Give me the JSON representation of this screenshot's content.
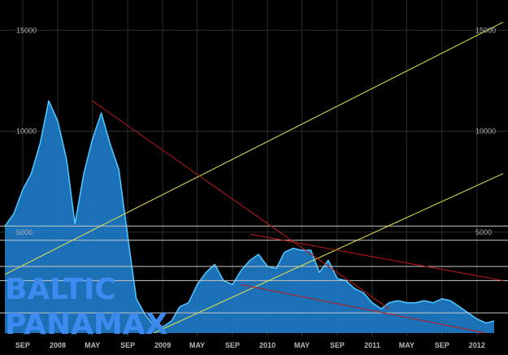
{
  "chart_data": {
    "type": "area",
    "title": "",
    "watermark": [
      "BALTIC",
      "PANAMAX"
    ],
    "xlabel": "",
    "ylabel": "",
    "x_tick_labels": [
      "SEP",
      "2008",
      "MAY",
      "SEP",
      "2009",
      "MAY",
      "SEP",
      "2010",
      "MAY",
      "SEP",
      "2011",
      "MAY",
      "SEP",
      "2012"
    ],
    "y_tick_labels": [
      "15000",
      "10000",
      "5000"
    ],
    "ylim": [
      0,
      16500
    ],
    "y_ticks": [
      5000,
      10000,
      15000
    ],
    "x": [
      "2007-07",
      "2007-08",
      "2007-09",
      "2007-10",
      "2007-11",
      "2007-12",
      "2008-01",
      "2008-02",
      "2008-03",
      "2008-04",
      "2008-05",
      "2008-06",
      "2008-07",
      "2008-08",
      "2008-09",
      "2008-10",
      "2008-11",
      "2008-12",
      "2009-01",
      "2009-02",
      "2009-03",
      "2009-04",
      "2009-05",
      "2009-06",
      "2009-07",
      "2009-08",
      "2009-09",
      "2009-10",
      "2009-11",
      "2009-12",
      "2010-01",
      "2010-02",
      "2010-03",
      "2010-04",
      "2010-05",
      "2010-06",
      "2010-07",
      "2010-08",
      "2010-09",
      "2010-10",
      "2010-11",
      "2010-12",
      "2011-01",
      "2011-02",
      "2011-03",
      "2011-04",
      "2011-05",
      "2011-06",
      "2011-07",
      "2011-08",
      "2011-09",
      "2011-10",
      "2011-11",
      "2011-12",
      "2012-01",
      "2012-02",
      "2012-03"
    ],
    "series": [
      {
        "color": "#1f7fcf",
        "values": [
          5300,
          5900,
          7100,
          7900,
          9400,
          11500,
          10500,
          8600,
          5400,
          7900,
          9600,
          10900,
          9400,
          8100,
          4800,
          1700,
          900,
          400,
          300,
          600,
          1300,
          1500,
          2400,
          3000,
          3400,
          2600,
          2400,
          3100,
          3600,
          3900,
          3300,
          3200,
          4000,
          4200,
          4100,
          4100,
          3000,
          3600,
          2700,
          2600,
          2200,
          2000,
          1500,
          1200,
          1500,
          1600,
          1500,
          1500,
          1600,
          1500,
          1700,
          1600,
          1300,
          1000,
          700,
          500,
          600
        ]
      }
    ],
    "horizontal_levels": [
      5300,
      4600,
      3300,
      2600,
      1000
    ],
    "trendlines": [
      {
        "color": "#e6e64d",
        "from": [
          "2007-07",
          2900
        ],
        "to": [
          "2012-04",
          15400
        ]
      },
      {
        "color": "#e6e64d",
        "from": [
          "2008-12",
          0
        ],
        "to": [
          "2012-04",
          7900
        ]
      },
      {
        "color": "#c01a1a",
        "from": [
          "2008-05",
          11500
        ],
        "to": [
          "2011-03",
          1200
        ]
      },
      {
        "color": "#c01a1a",
        "from": [
          "2009-11",
          4900
        ],
        "to": [
          "2012-04",
          2600
        ]
      },
      {
        "color": "#c01a1a",
        "from": [
          "2009-10",
          2400
        ],
        "to": [
          "2012-02",
          0
        ]
      }
    ],
    "grid": true,
    "colors": {
      "background": "#000000",
      "area_fill": "#1f7fcf",
      "area_line": "#4ec4ff",
      "grid": "#2e2e2e",
      "level_line": "#c8c8c8",
      "watermark": "#3d8bf0"
    }
  }
}
